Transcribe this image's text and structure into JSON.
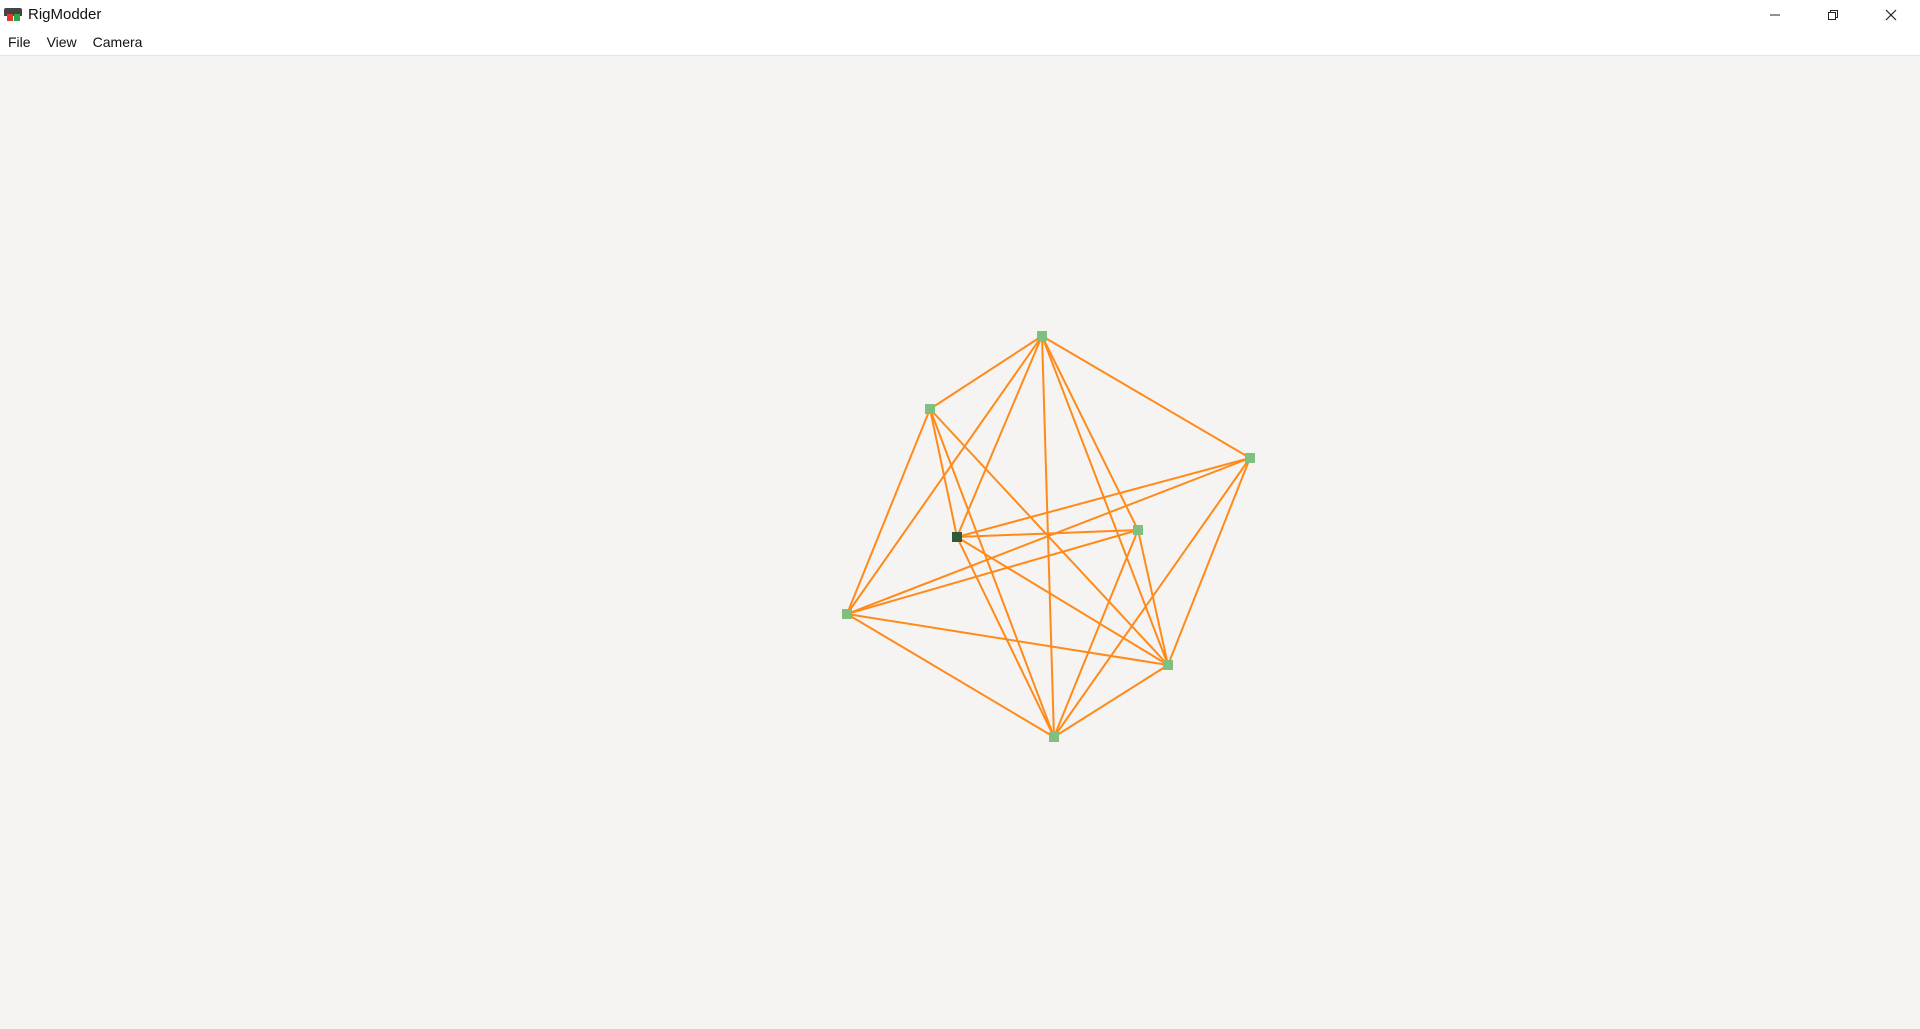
{
  "window": {
    "title": "RigModder",
    "controls": {
      "minimize_icon": "minimize-icon",
      "maximize_icon": "restore-icon",
      "close_icon": "close-icon"
    }
  },
  "menubar": {
    "items": [
      {
        "label": "File"
      },
      {
        "label": "View"
      },
      {
        "label": "Camera"
      }
    ]
  },
  "viewport": {
    "edge_color": "#ff8a1a",
    "node_color": "#7fbf7f",
    "selected_node_color": "#2d5a3d",
    "nodes": [
      {
        "id": "n-top",
        "selected": false
      },
      {
        "id": "n-upper-left",
        "selected": false
      },
      {
        "id": "n-right",
        "selected": false
      },
      {
        "id": "n-center-left",
        "selected": true
      },
      {
        "id": "n-center-right",
        "selected": false
      },
      {
        "id": "n-left",
        "selected": false
      },
      {
        "id": "n-lower-right",
        "selected": false
      },
      {
        "id": "n-bottom",
        "selected": false
      }
    ],
    "edges": [
      [
        "n-top",
        "n-upper-left"
      ],
      [
        "n-top",
        "n-right"
      ],
      [
        "n-top",
        "n-center-left"
      ],
      [
        "n-top",
        "n-left"
      ],
      [
        "n-top",
        "n-bottom"
      ],
      [
        "n-top",
        "n-lower-right"
      ],
      [
        "n-upper-left",
        "n-center-left"
      ],
      [
        "n-upper-left",
        "n-left"
      ],
      [
        "n-upper-left",
        "n-bottom"
      ],
      [
        "n-upper-left",
        "n-lower-right"
      ],
      [
        "n-right",
        "n-center-left"
      ],
      [
        "n-right",
        "n-left"
      ],
      [
        "n-right",
        "n-lower-right"
      ],
      [
        "n-right",
        "n-bottom"
      ],
      [
        "n-center-left",
        "n-center-right"
      ],
      [
        "n-center-left",
        "n-lower-right"
      ],
      [
        "n-center-left",
        "n-bottom"
      ],
      [
        "n-center-right",
        "n-left"
      ],
      [
        "n-center-right",
        "n-lower-right"
      ],
      [
        "n-center-right",
        "n-bottom"
      ],
      [
        "n-center-right",
        "n-top"
      ],
      [
        "n-left",
        "n-lower-right"
      ],
      [
        "n-left",
        "n-bottom"
      ],
      [
        "n-lower-right",
        "n-bottom"
      ]
    ]
  }
}
